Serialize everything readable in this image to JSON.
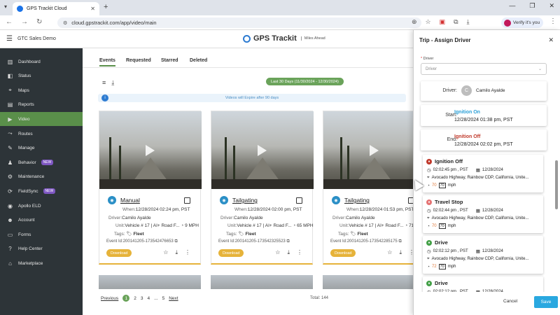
{
  "browser": {
    "tab_title": "GPS Trackit Cloud",
    "url": "cloud.gpstrackit.com/app/video/main",
    "profile_label": "Verify it's you"
  },
  "header": {
    "company": "GTC Sales Demo",
    "logo_name": "GPS Trackit",
    "logo_tagline": "Miles Ahead"
  },
  "sidebar": {
    "items": [
      {
        "label": "Dashboard",
        "icon": "dashboard-icon",
        "glyph": "▥"
      },
      {
        "label": "Status",
        "icon": "status-icon",
        "glyph": "◧"
      },
      {
        "label": "Maps",
        "icon": "map-pin-icon",
        "glyph": "⌖"
      },
      {
        "label": "Reports",
        "icon": "reports-icon",
        "glyph": "▤"
      },
      {
        "label": "Video",
        "icon": "video-icon",
        "glyph": "▶"
      },
      {
        "label": "Routes",
        "icon": "routes-icon",
        "glyph": "⤳"
      },
      {
        "label": "Manage",
        "icon": "wrench-icon",
        "glyph": "✎"
      },
      {
        "label": "Behavior",
        "icon": "behavior-icon",
        "glyph": "♟",
        "badge": "NEW"
      },
      {
        "label": "Maintenance",
        "icon": "maintenance-icon",
        "glyph": "⚙"
      },
      {
        "label": "FieldSync",
        "icon": "fieldsync-icon",
        "glyph": "⟳",
        "badge": "NEW"
      },
      {
        "label": "Apollo ELD",
        "icon": "eld-icon",
        "glyph": "◉"
      },
      {
        "label": "Account",
        "icon": "account-icon",
        "glyph": "☻"
      },
      {
        "label": "Forms",
        "icon": "forms-icon",
        "glyph": "▭"
      },
      {
        "label": "Help Center",
        "icon": "help-icon",
        "glyph": "?"
      },
      {
        "label": "Marketplace",
        "icon": "marketplace-icon",
        "glyph": "⌂"
      }
    ],
    "active": "Video",
    "accent": "#5a8f4a"
  },
  "main": {
    "tabs": [
      "Events",
      "Requested",
      "Starred",
      "Deleted"
    ],
    "active_tab": "Events",
    "date_range": "Last 30 Days (11/30/2024 - 12/30/2024)",
    "expire_notice": "Videos will Expire after 90 days",
    "cards": [
      {
        "title": "Manual",
        "when": "12/28/2024 02:24 pm, PST",
        "driver": "Camilo Ayalde",
        "unit": "Vehicle # 17 | AI+ Road F...",
        "speed": "9 MPH",
        "tags": "Fleet",
        "event_id": "200141205-173542476653",
        "download": "Download"
      },
      {
        "title": "Tailgating",
        "when": "12/28/2024 02:00 pm, PST",
        "driver": "Camilo Ayalde",
        "unit": "Vehicle # 17 | AI+ Road F...",
        "speed": "65 MPH",
        "tags": "Fleet",
        "event_id": "200141205-173542325523",
        "download": "Download"
      },
      {
        "title": "Tailgating",
        "when": "12/28/2024 01:53 pm, PST",
        "driver": "Camilo Ayalde",
        "unit": "Vehicle # 17 | AI+ Road F...",
        "speed": "71 M",
        "tags": "Fleet",
        "event_id": "200141205-173542285175",
        "download": "Download"
      }
    ],
    "labels": {
      "when": "When:",
      "driver": "Driver:",
      "unit": "Unit:",
      "tags": "Tags:",
      "event_id": "Event Id:"
    },
    "pagination": {
      "prev": "Previous",
      "pages": [
        "1",
        "2",
        "3",
        "4",
        "5"
      ],
      "ellipsis": "...",
      "next": "Next",
      "current": "1",
      "total": "Total: 144"
    }
  },
  "panel": {
    "title": "Trip - Assign Driver",
    "driver_label": "Driver",
    "driver_placeholder": "Driver",
    "driver_key": "Driver:",
    "driver_initial": "C",
    "driver_name": "Camilo Ayalde",
    "start_key": "Start:",
    "start_event": "Ignition On",
    "start_time": "12/28/2024 01:38 pm, PST",
    "end_key": "End:",
    "end_event": "Ignition Off",
    "end_time": "12/28/2024 02:02 pm, PST",
    "events": [
      {
        "title": "Ignition Off",
        "time": "02:02:45 pm , PST",
        "date": "12/28/2024",
        "address": "Avocado Highway, Rainbow CDP, California, Unite...",
        "speed": "70",
        "limit": "70",
        "unit": "mph",
        "color": "#c0392b"
      },
      {
        "title": "Travel Stop",
        "time": "02:02:44 pm , PST",
        "date": "12/28/2024",
        "address": "Avocado Highway, Rainbow CDP, California, Unite...",
        "speed": "70",
        "limit": "70",
        "unit": "mph",
        "color": "#e57373"
      },
      {
        "title": "Drive",
        "time": "02:02:12 pm , PST",
        "date": "12/28/2024",
        "address": "Avocado Highway, Rainbow CDP, California, Unite...",
        "speed": "72",
        "limit": "70",
        "unit": "mph",
        "color": "#43a047"
      },
      {
        "title": "Drive",
        "time": "02:02:12 pm , PST",
        "date": "12/28/2024",
        "address": "",
        "speed": "",
        "limit": "",
        "unit": "",
        "color": "#43a047"
      }
    ],
    "cancel": "Cancel",
    "save": "Save"
  }
}
